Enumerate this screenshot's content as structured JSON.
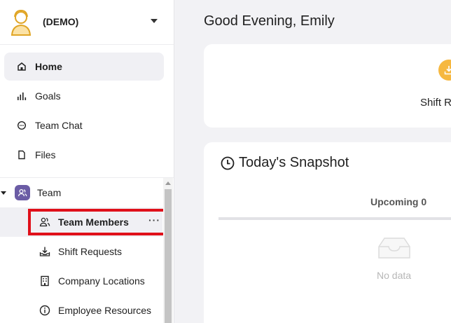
{
  "org": {
    "name": "(DEMO)"
  },
  "nav": [
    {
      "label": "Home",
      "icon": "home-icon"
    },
    {
      "label": "Goals",
      "icon": "bar-chart-icon"
    },
    {
      "label": "Team Chat",
      "icon": "chat-icon"
    },
    {
      "label": "Files",
      "icon": "file-icon"
    }
  ],
  "team": {
    "label": "Team",
    "items": [
      {
        "label": "Team Members",
        "icon": "users-icon",
        "more": "···"
      },
      {
        "label": "Shift Requests",
        "icon": "download-tray-icon"
      },
      {
        "label": "Company Locations",
        "icon": "building-icon"
      },
      {
        "label": "Employee Resources",
        "icon": "info-icon"
      }
    ]
  },
  "main": {
    "greeting": "Good Evening, Emily",
    "shift_card_label": "Shift R",
    "snapshot_title": "Today's Snapshot",
    "upcoming_tab": "Upcoming 0",
    "empty_text": "No data"
  },
  "colors": {
    "accent_purple": "#6b5ca5",
    "highlight_red": "#e0101a",
    "badge_orange": "#f6b840"
  }
}
